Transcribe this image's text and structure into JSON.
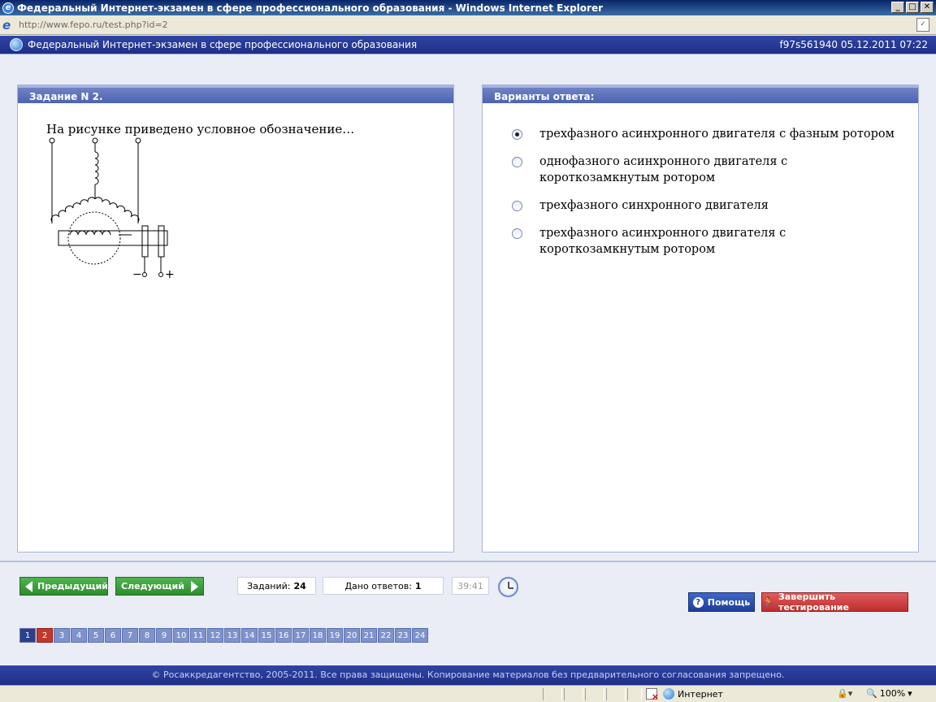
{
  "window": {
    "title": "Федеральный Интернет-экзамен в сфере профессионального образования - Windows Internet Explorer",
    "url": "http://www.fepo.ru/test.php?id=2",
    "buttons": [
      "_",
      "□",
      "✕"
    ]
  },
  "header": {
    "title": "Федеральный Интернет-экзамен в сфере профессионального образования",
    "meta": "f97s561940 05.12.2011 07:22"
  },
  "task": {
    "heading": "Задание N 2.",
    "text": "На рисунке приведено условное обозначение…",
    "minus_label": "−",
    "plus_label": "+"
  },
  "answers": {
    "heading": "Варианты ответа:",
    "options": [
      {
        "label": "трехфазного асинхронного двигателя с фазным ротором",
        "selected": true
      },
      {
        "label": "однофазного асинхронного двигателя с короткозамкнутым ротором",
        "selected": false
      },
      {
        "label": "трехфазного синхронного двигателя",
        "selected": false
      },
      {
        "label": "трехфазного асинхронного двигателя с короткозамкнутым ротором",
        "selected": false
      }
    ]
  },
  "nav": {
    "prev_label": "Предыдущий",
    "next_label": "Следующий",
    "tasks_label": "Заданий:",
    "tasks_value": "24",
    "answers_label": "Дано ответов:",
    "answers_value": "1",
    "timer": "39:41",
    "help_label": "Помощь",
    "finish_label": "Завершить тестирование"
  },
  "pager": {
    "pages": [
      "1",
      "2",
      "3",
      "4",
      "5",
      "6",
      "7",
      "8",
      "9",
      "10",
      "11",
      "12",
      "13",
      "14",
      "15",
      "16",
      "17",
      "18",
      "19",
      "20",
      "21",
      "22",
      "23",
      "24"
    ],
    "current": "2",
    "visited": [
      "1"
    ]
  },
  "footer": {
    "text": "© Росаккредагентство, 2005-2011. Все права защищены. Копирование материалов без предварительного согласования запрещено."
  },
  "statusbar": {
    "zone": "Интернет",
    "zoom": "100%",
    "zoom_arrow": "▾",
    "lock_arrow": "▾"
  },
  "colors": {
    "header_blue": "#1f2f86",
    "panel_header": "#4d63b3",
    "green_button": "#2e8c2e",
    "red_button": "#c02d2d",
    "current_page": "#c0392b"
  }
}
